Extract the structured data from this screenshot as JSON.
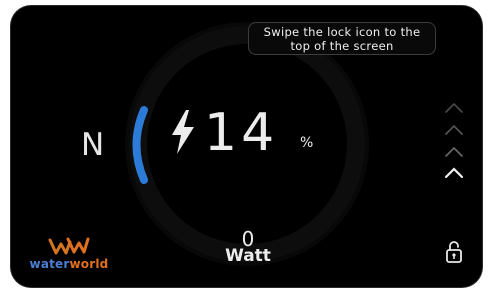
{
  "hint": {
    "text": "Swipe the lock icon to the top of the screen"
  },
  "status": {
    "gear": "N",
    "battery_percent": "14",
    "battery_unit": "%",
    "power_value": "0",
    "power_unit": "Watt"
  },
  "brand": {
    "name_part1": "water",
    "name_part2": "world",
    "color_primary": "#4a7fd4",
    "color_accent": "#e0701f"
  },
  "icons": {
    "bolt": "lightning-bolt-icon",
    "chevrons": "chevron-up-icon",
    "lock": "unlocked-padlock-icon"
  },
  "colors": {
    "gear_arc": "#2d7bd8",
    "background": "#000000",
    "text": "#ececec"
  }
}
